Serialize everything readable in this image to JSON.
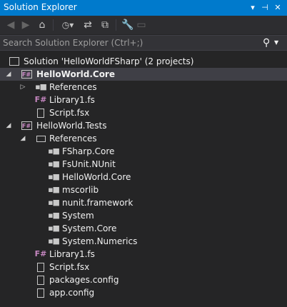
{
  "window": {
    "title": "Solution Explorer",
    "controls": [
      "▾",
      "⊣",
      "✕"
    ]
  },
  "toolbar": {
    "back_icon": "arrow-left-icon",
    "forward_icon": "arrow-right-icon",
    "home_icon": "home-icon",
    "history_icon": "history-icon",
    "sync_icon": "sync-icon",
    "collapse_icon": "collapse-all-icon",
    "properties_icon": "wrench-icon",
    "preview_icon": "preview-icon"
  },
  "search": {
    "placeholder": "Search Solution Explorer (Ctrl+;)"
  },
  "tree": {
    "solution": "Solution 'HelloWorldFSharp' (2 projects)",
    "projects": [
      {
        "name": "HelloWorld.Core",
        "icon_label": "F#",
        "references": "References",
        "files": [
          "Library1.fs",
          "Script.fsx"
        ]
      },
      {
        "name": "HelloWorld.Tests",
        "icon_label": "F#",
        "references": "References",
        "reference_items": [
          "FSharp.Core",
          "FsUnit.NUnit",
          "HelloWorld.Core",
          "mscorlib",
          "nunit.framework",
          "System",
          "System.Core",
          "System.Numerics"
        ],
        "files": [
          "Library1.fs",
          "Script.fsx",
          "packages.config",
          "app.config"
        ]
      }
    ]
  },
  "colors": {
    "title_bar": "#007acc",
    "background": "#252526",
    "selection": "#3f3f46",
    "fsharp_purple": "#c586c0"
  }
}
